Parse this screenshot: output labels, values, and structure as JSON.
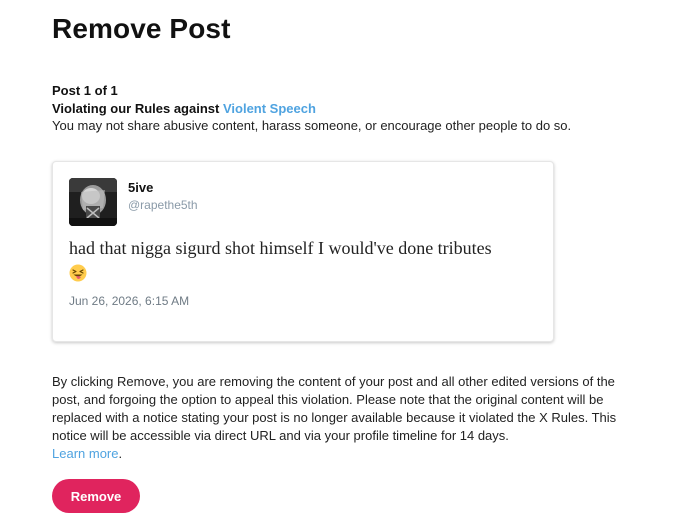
{
  "page": {
    "title": "Remove Post"
  },
  "violation": {
    "post_count": "Post 1 of 1",
    "rule_prefix": "Violating our Rules against ",
    "rule_name": "Violent Speech",
    "description": "You may not share abusive content, harass someone, or encourage other people to do so."
  },
  "tweet": {
    "author_name": "5ive",
    "author_handle": "@rapethe5th",
    "text": "had that nigga sigurd shot himself I would've done tributes",
    "emoji": "squinting-face-with-tongue-icon",
    "date": "Jun 26, 2026, 6:15 AM"
  },
  "notice": {
    "text": "By clicking Remove, you are removing the content of your post and all other edited versions of the post, and forgoing the option to appeal this violation. Please note that the original content will be replaced with a notice stating your post is no longer available because it violated the X Rules. This notice will be accessible via direct URL and via your profile timeline for 14 days.",
    "learn_more": "Learn more",
    "learn_more_suffix": "."
  },
  "actions": {
    "remove_label": "Remove"
  },
  "colors": {
    "link": "#4fa3e0",
    "remove_button": "#e0245e",
    "handle": "#8a9aa8"
  }
}
